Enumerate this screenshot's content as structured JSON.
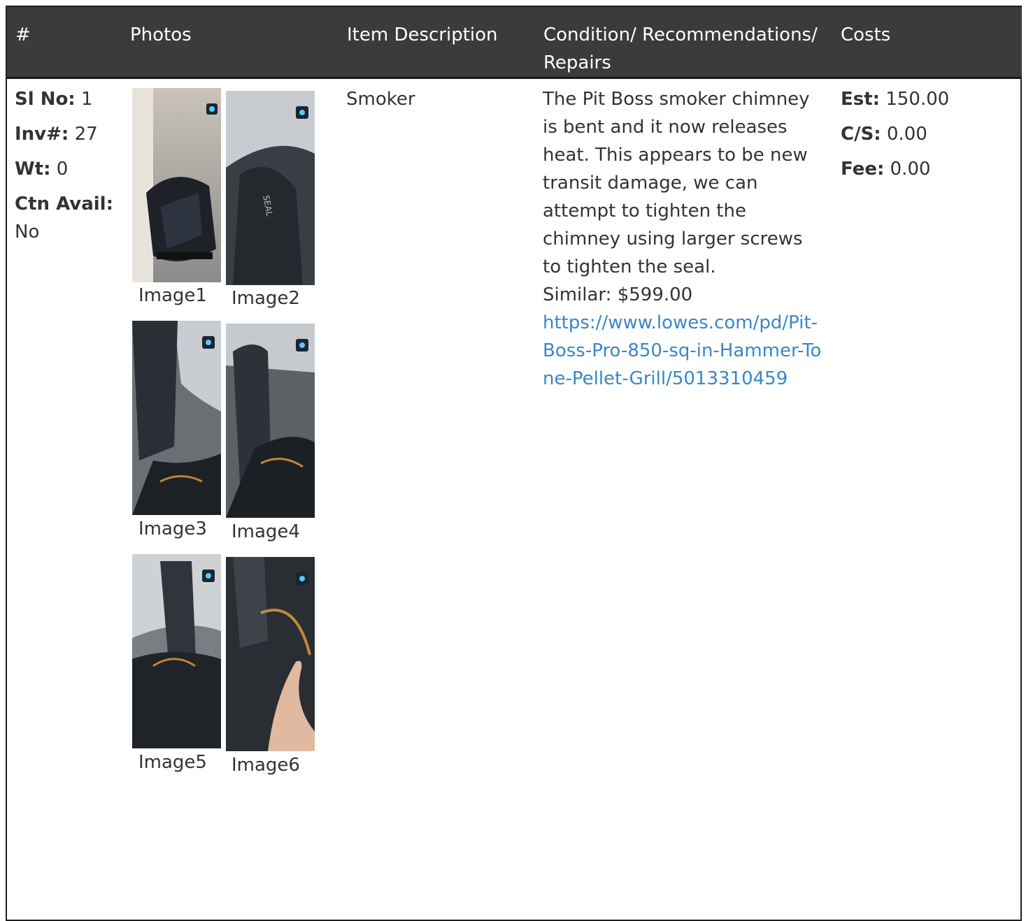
{
  "header": {
    "num": "#",
    "photos": "Photos",
    "description": "Item Description",
    "condition": "Condition/ Recommendations/ Repairs",
    "costs": "Costs"
  },
  "item": {
    "sl_no_label": "Sl No:",
    "sl_no": "1",
    "inv_label": "Inv#:",
    "inv": "27",
    "wt_label": "Wt:",
    "wt": "0",
    "ctn_label": "Ctn Avail:",
    "ctn": "No",
    "description": "Smoker",
    "condition": "The Pit Boss smoker chimney is bent and it now releases heat. This appears to be new transit damage, we can attempt to tighten the chimney using larger screws to tighten the seal.",
    "similar": "Similar: $599.00",
    "link": "https://www.lowes.com/pd/Pit-Boss-Pro-850-sq-in-Hammer-Tone-Pellet-Grill/5013310459",
    "est_label": "Est:",
    "est": "150.00",
    "cs_label": "C/S:",
    "cs": "0.00",
    "fee_label": "Fee:",
    "fee": "0.00"
  },
  "photos": [
    {
      "caption": "Image1"
    },
    {
      "caption": "Image2"
    },
    {
      "caption": "Image3"
    },
    {
      "caption": "Image4"
    },
    {
      "caption": "Image5"
    },
    {
      "caption": "Image6"
    }
  ],
  "colors": {
    "header_bg": "#3b3b3b",
    "link": "#3a87c8",
    "text": "#333333"
  }
}
